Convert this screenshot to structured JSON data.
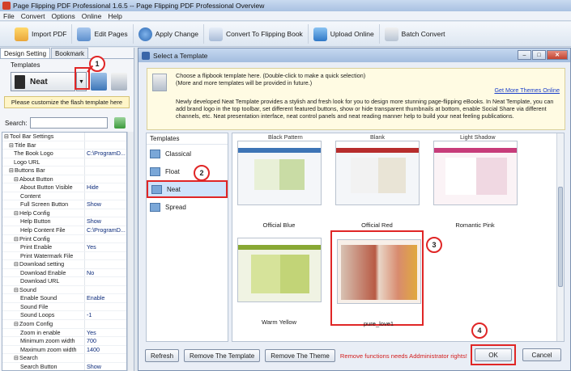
{
  "window": {
    "title": "Page Flipping PDF Professional 1.6.5  -- Page Flipping PDF Professional Overview"
  },
  "menu": [
    "File",
    "Convert",
    "Options",
    "Online",
    "Help"
  ],
  "toolbar": {
    "import": "Import PDF",
    "edit": "Edit Pages",
    "apply": "Apply Change",
    "convert": "Convert To Flipping Book",
    "upload": "Upload Online",
    "batch": "Batch Convert"
  },
  "left_panel": {
    "tabs": [
      "Design Setting",
      "Bookmark"
    ],
    "templates_label": "Templates",
    "template_name": "Neat",
    "customize_hint": "Please customize the flash template here",
    "search_label": "Search:",
    "settings": [
      {
        "key": "Tool Bar Settings",
        "value": ""
      },
      {
        "key": "Title Bar",
        "value": ""
      },
      {
        "key": "The Book Logo",
        "value": "C:\\ProgramD..."
      },
      {
        "key": "Logo URL",
        "value": ""
      },
      {
        "key": "Buttons Bar",
        "value": ""
      },
      {
        "key": "About Button",
        "value": ""
      },
      {
        "key": "About Button Visible",
        "value": "Hide"
      },
      {
        "key": "Content",
        "value": ""
      },
      {
        "key": "Full Screen Button",
        "value": "Show"
      },
      {
        "key": "Help Config",
        "value": ""
      },
      {
        "key": "Help Button",
        "value": "Show"
      },
      {
        "key": "Help Content File",
        "value": "C:\\ProgramD..."
      },
      {
        "key": "Print Config",
        "value": ""
      },
      {
        "key": "Print Enable",
        "value": "Yes"
      },
      {
        "key": "Print Watermark File",
        "value": ""
      },
      {
        "key": "Download setting",
        "value": ""
      },
      {
        "key": "Download Enable",
        "value": "No"
      },
      {
        "key": "Download URL",
        "value": ""
      },
      {
        "key": "Sound",
        "value": ""
      },
      {
        "key": "Enable Sound",
        "value": "Enable"
      },
      {
        "key": "Sound File",
        "value": ""
      },
      {
        "key": "Sound Loops",
        "value": "-1"
      },
      {
        "key": "Zoom Config",
        "value": ""
      },
      {
        "key": "Zoom in enable",
        "value": "Yes"
      },
      {
        "key": "Minimum zoom width",
        "value": "700"
      },
      {
        "key": "Maximum zoom width",
        "value": "1400"
      },
      {
        "key": "Search",
        "value": ""
      },
      {
        "key": "Search Button",
        "value": "Show"
      }
    ]
  },
  "dialog": {
    "title": "Select a Template",
    "info_line1": "Choose a flipbook template here. (Double-click to make a quick selection)",
    "info_line2": "(More and more templates will be provided in future.)",
    "more_link": "Get More Themes Online",
    "info_para": "Newly developed Neat Template provides a stylish and fresh look for you to design more stunning page-flipping eBooks. In Neat Template, you can add brand logo in the top toolbar, set different featured buttons, show or hide transparent thumbnails at bottom, enable Social Share via different channels, etc. Neat presentation interface, neat control panels and neat reading manner help to build your neat feeling publications.",
    "templates_header": "Templates",
    "template_items": [
      "Classical",
      "Float",
      "Neat",
      "Spread"
    ],
    "selected_template": "Neat",
    "grid_top_labels": [
      "Black Pattern",
      "Blank",
      "Light Shadow"
    ],
    "themes": [
      "Official Blue",
      "Official Red",
      "Romantic Pink",
      "Warm Yellow",
      "pure_love1"
    ],
    "selected_theme": "pure_love1",
    "buttons": {
      "refresh": "Refresh",
      "remove_template": "Remove The Template",
      "remove_theme": "Remove The Theme",
      "warning": "Remove functions needs Addministrator rights!",
      "ok": "OK",
      "cancel": "Cancel"
    }
  },
  "annotations": [
    "1",
    "2",
    "3",
    "4"
  ],
  "colors": {
    "annotation": "#e02626",
    "link": "#1a3ec9",
    "warning": "#d21c1c"
  }
}
